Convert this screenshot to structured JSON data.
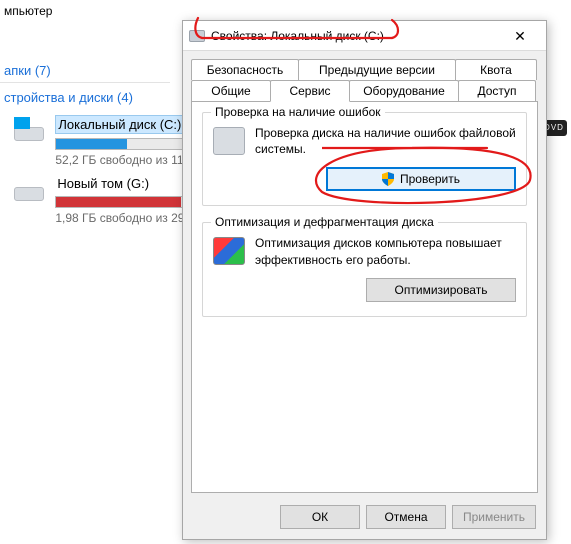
{
  "explorer": {
    "crumb": "мпьютер",
    "section_folders": "апки (7)",
    "section_drives": "стройства и диски (4)",
    "drives": [
      {
        "name": "Локальный диск (C:)",
        "free": "52,2 ГБ свободно из 11"
      },
      {
        "name": "Новый том (G:)",
        "free": "1,98 ГБ свободно из 29"
      }
    ],
    "dvd": "DVD"
  },
  "dialog": {
    "title": "Свойства: Локальный диск (C:)",
    "tabs_row1": [
      "Безопасность",
      "Предыдущие версии",
      "Квота"
    ],
    "tabs_row2": [
      "Общие",
      "Сервис",
      "Оборудование",
      "Доступ"
    ],
    "group_check": {
      "legend": "Проверка на наличие ошибок",
      "text": "Проверка диска на наличие ошибок файловой системы.",
      "button": "Проверить"
    },
    "group_defrag": {
      "legend": "Оптимизация и дефрагментация диска",
      "text": "Оптимизация дисков компьютера повышает эффективность его работы.",
      "button": "Оптимизировать"
    },
    "buttons": {
      "ok": "ОК",
      "cancel": "Отмена",
      "apply": "Применить"
    }
  }
}
